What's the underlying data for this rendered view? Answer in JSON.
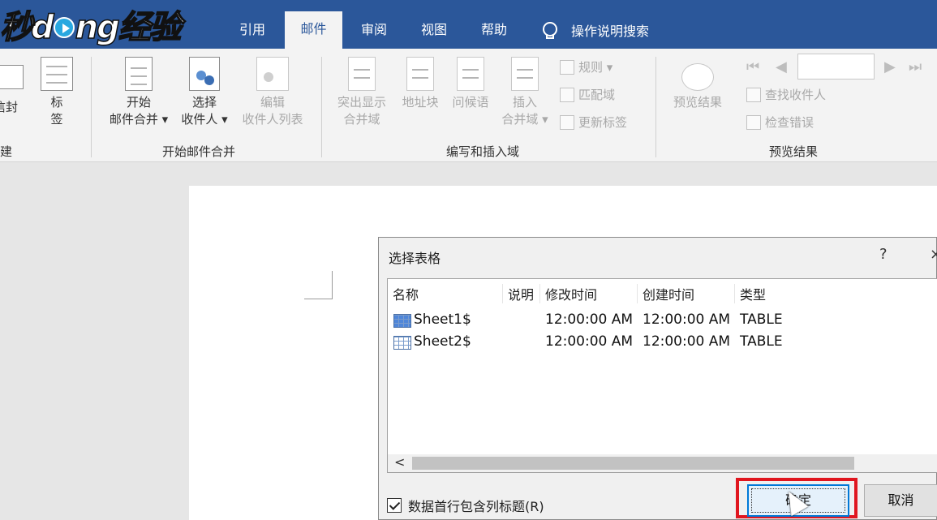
{
  "watermark": {
    "text_a": "秒d",
    "text_b": "ng经验"
  },
  "tabs": [
    {
      "label": "引用"
    },
    {
      "label": "邮件"
    },
    {
      "label": "审阅"
    },
    {
      "label": "视图"
    },
    {
      "label": "帮助"
    }
  ],
  "tell_me": {
    "label": "操作说明搜索"
  },
  "ribbon": {
    "create_group": {
      "envelope_label": "信封",
      "label_line1": "标",
      "label_line2": "签",
      "group_label": "建"
    },
    "start_group": {
      "start_merge_line1": "开始",
      "start_merge_line2": "邮件合并 ▾",
      "select_recipients_line1": "选择",
      "select_recipients_line2": "收件人 ▾",
      "edit_list_line1": "编辑",
      "edit_list_line2": "收件人列表",
      "group_label": "开始邮件合并"
    },
    "write_group": {
      "highlight_line1": "突出显示",
      "highlight_line2": "合并域",
      "address_block": "地址块",
      "greeting_line": "问候语",
      "insert_field_line1": "插入",
      "insert_field_line2": "合并域 ▾",
      "rules": "规则 ▾",
      "match_fields": "匹配域",
      "update_labels": "更新标签",
      "group_label": "编写和插入域"
    },
    "preview_group": {
      "preview_results": "预览结果",
      "find_recipient": "查找收件人",
      "check_errors": "检查错误",
      "group_label": "预览结果"
    }
  },
  "dialog": {
    "title": "选择表格",
    "help": "?",
    "close": "×",
    "columns": [
      "名称",
      "说明",
      "修改时间",
      "创建时间",
      "类型"
    ],
    "rows": [
      {
        "name": "Sheet1$",
        "desc": "",
        "modified": "12:00:00 AM",
        "created": "12:00:00 AM",
        "type": "TABLE"
      },
      {
        "name": "Sheet2$",
        "desc": "",
        "modified": "12:00:00 AM",
        "created": "12:00:00 AM",
        "type": "TABLE"
      }
    ],
    "scroll_left": "<",
    "first_row_header_label": "数据首行包含列标题(R)",
    "ok_label": "确定",
    "cancel_label": "取消"
  },
  "colors": {
    "accent": "#2b579a",
    "highlight": "#e0161f",
    "ok_border": "#0078d7"
  }
}
